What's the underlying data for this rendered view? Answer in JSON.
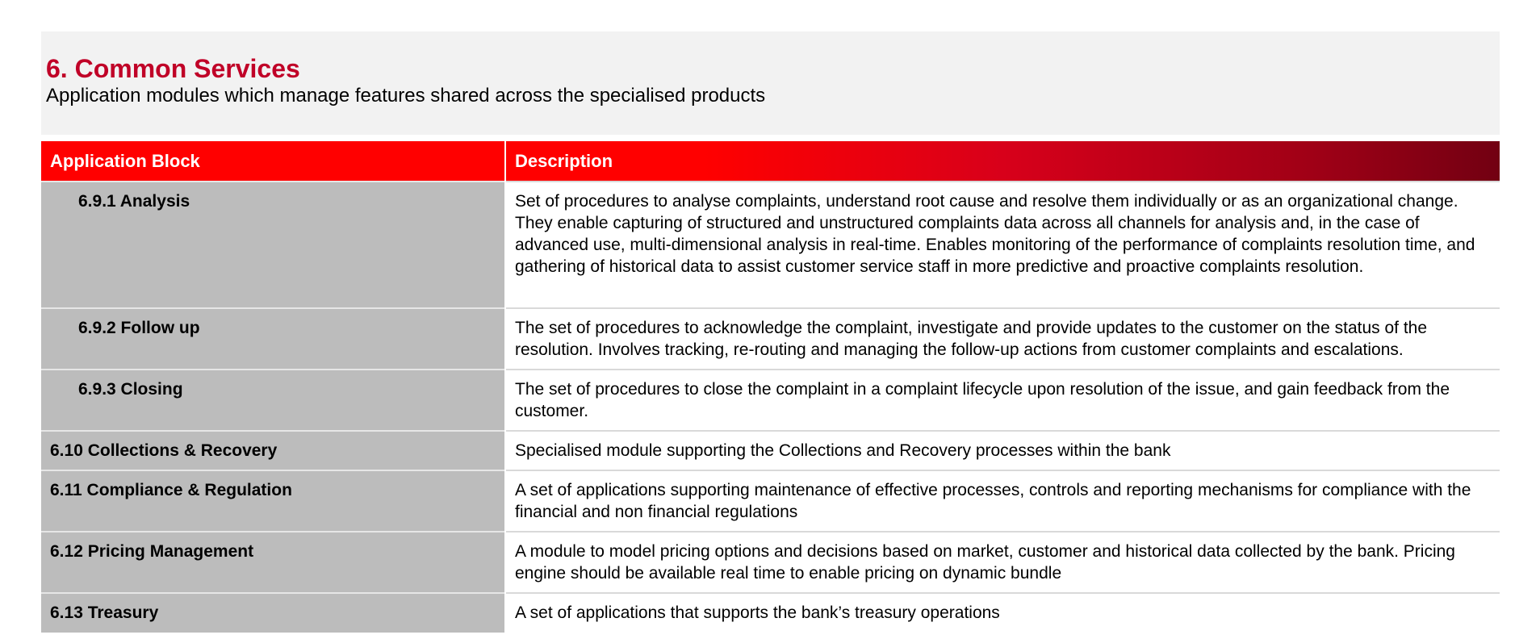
{
  "page": {
    "title": "6. Common Services",
    "subtitle": "Application modules which manage features shared across the specialised products"
  },
  "table": {
    "headers": {
      "block": "Application Block",
      "description": "Description"
    },
    "rows": [
      {
        "block": "6.9.1 Analysis",
        "description": "Set of procedures to analyse complaints, understand root cause and resolve them individually or as an organizational change. They enable capturing of structured and unstructured complaints data across all channels for analysis and, in the case of advanced use, multi-dimensional analysis in real-time. Enables monitoring of the performance of complaints resolution time, and gathering of historical data to assist customer service staff in more predictive and proactive complaints resolution."
      },
      {
        "block": "6.9.2 Follow up",
        "description": "The set of procedures to acknowledge the complaint, investigate and provide updates to the customer on the status of the resolution. Involves tracking, re-routing and managing the follow-up actions from customer complaints and escalations."
      },
      {
        "block": "6.9.3 Closing",
        "description": "The set of procedures to close the complaint in a complaint lifecycle upon resolution of the issue, and gain feedback from the customer."
      },
      {
        "block": "6.10 Collections & Recovery",
        "description": "Specialised module supporting the Collections and Recovery processes within the bank"
      },
      {
        "block": "6.11 Compliance & Regulation",
        "description": "A set of applications supporting maintenance of effective processes, controls  and reporting mechanisms for compliance with the financial and non financial regulations"
      },
      {
        "block": "6.12 Pricing Management",
        "description": "A module to model pricing options and decisions based on market, customer and historical data collected by the bank. Pricing engine should be available real time to enable pricing on dynamic bundle"
      },
      {
        "block": "6.13 Treasury",
        "description": "A set of applications that supports the bank’s treasury operations"
      }
    ]
  },
  "colors": {
    "title": "#c00027",
    "header_red": "#ff0000",
    "header_dark": "#720012",
    "block_cell": "#bcbcbc",
    "band": "#f2f2f2"
  }
}
